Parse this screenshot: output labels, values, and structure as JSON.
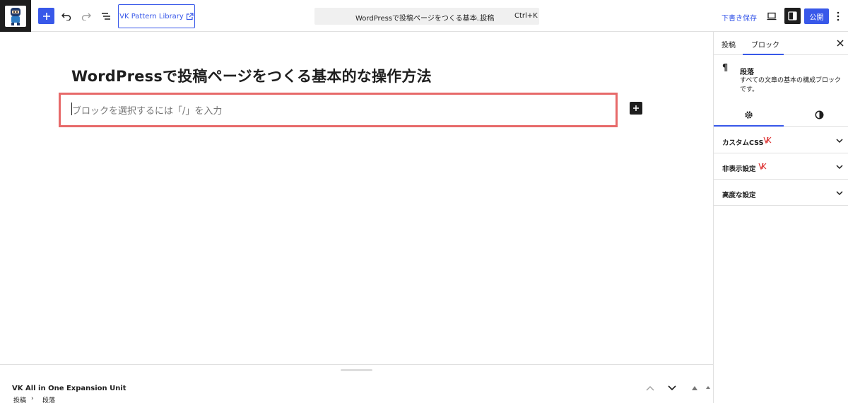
{
  "toolbar": {
    "pattern_library_label": "VK Pattern Library",
    "document_title": "WordPressで投稿ページをつくる基本...",
    "post_type": "· 投稿",
    "shortcut": "Ctrl+K",
    "save_draft_label": "下書き保存",
    "publish_label": "公開"
  },
  "editor": {
    "post_title": "WordPressで投稿ページをつくる基本的な操作方法",
    "paragraph_placeholder": "ブロックを選択するには「/」を入力"
  },
  "metabox": {
    "title": "VK All in One Expansion Unit"
  },
  "breadcrumb": {
    "items": [
      "投稿",
      "段落"
    ]
  },
  "sidebar": {
    "tabs": [
      "投稿",
      "ブロック"
    ],
    "block_name": "段落",
    "block_description": "すべての文章の基本の構成ブロックです。",
    "panels": [
      "カスタムCSS",
      "非表示設定",
      "高度な設定"
    ]
  },
  "colors": {
    "accent": "#3858e9",
    "highlight": "#e76a6a",
    "vk_badge": "#d33"
  }
}
